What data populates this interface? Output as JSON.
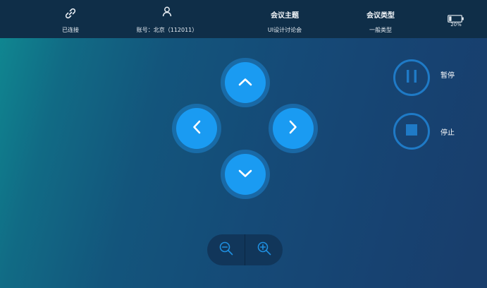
{
  "status_bar": {
    "connection": {
      "icon": "link-icon",
      "label": "已连接"
    },
    "account": {
      "icon": "user-icon",
      "label": "账号：北京（112011）"
    },
    "meeting_topic": {
      "title": "会议主题",
      "value": "UI设计讨论会"
    },
    "meeting_type": {
      "title": "会议类型",
      "value": "一般类型"
    },
    "battery": {
      "icon": "battery-icon",
      "percent": "20%",
      "level": 0.2
    }
  },
  "direction_pad": {
    "up": {
      "icon": "chevron-up-icon"
    },
    "left": {
      "icon": "chevron-left-icon"
    },
    "right": {
      "icon": "chevron-right-icon"
    },
    "down": {
      "icon": "chevron-down-icon"
    }
  },
  "controls": {
    "pause": {
      "icon": "pause-icon",
      "label": "暂停"
    },
    "stop": {
      "icon": "stop-icon",
      "label": "停止"
    }
  },
  "zoom": {
    "zoom_out": {
      "icon": "zoom-out-icon"
    },
    "zoom_in": {
      "icon": "zoom-in-icon"
    }
  },
  "colors": {
    "accent": "#1a9bf2",
    "topbar": "#0f2e48",
    "control_ring": "#1f7ac6"
  }
}
